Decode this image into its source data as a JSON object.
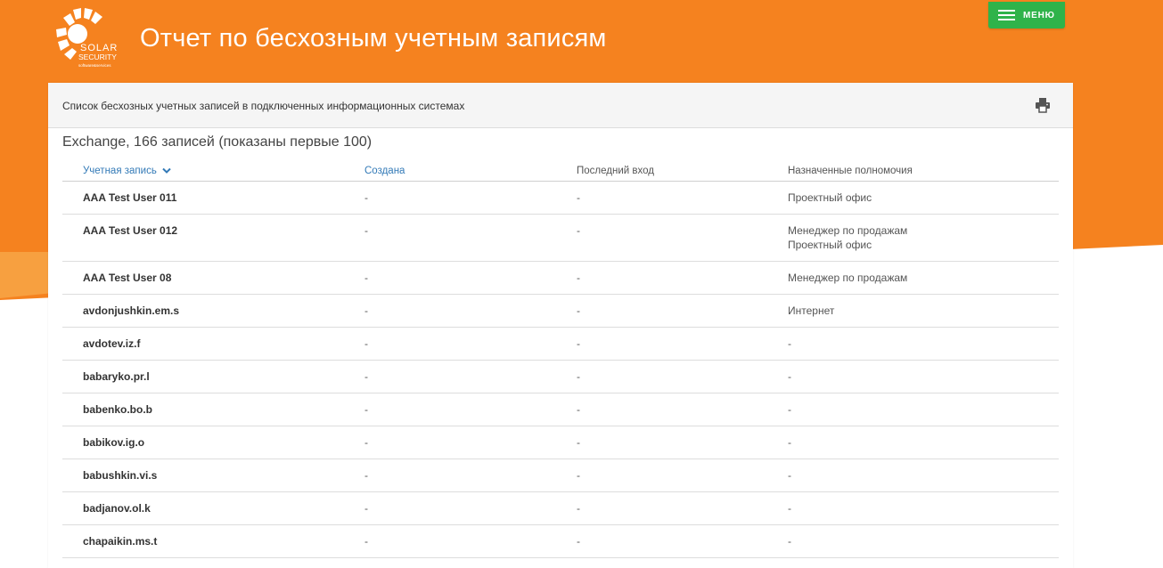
{
  "header": {
    "logo_text_1": "SOLAR",
    "logo_text_2": "SECURITY",
    "logo_text_3": "software&services",
    "title": "Отчет по бесхозным учетным записям",
    "menu_label": "МЕНЮ"
  },
  "panel": {
    "description": "Список бесхозных учетных записей в подключенных информационных системах",
    "print_icon": "printer-icon",
    "section_title": "Exchange, 166 записей (показаны первые 100)"
  },
  "table": {
    "columns": [
      "Учетная запись",
      "Создана",
      "Последний вход",
      "Назначенные полномочия"
    ],
    "sort_icon": "chevron-down-icon",
    "rows": [
      {
        "account": "AAA Test User 011",
        "created": "-",
        "last_login": "-",
        "permissions": [
          "Проектный офис"
        ]
      },
      {
        "account": "AAA Test User 012",
        "created": "-",
        "last_login": "-",
        "permissions": [
          "Менеджер по продажам",
          "Проектный офис"
        ]
      },
      {
        "account": "AAA Test User 08",
        "created": "-",
        "last_login": "-",
        "permissions": [
          "Менеджер по продажам"
        ]
      },
      {
        "account": "avdonjushkin.em.s",
        "created": "-",
        "last_login": "-",
        "permissions": [
          "Интернет"
        ]
      },
      {
        "account": "avdotev.iz.f",
        "created": "-",
        "last_login": "-",
        "permissions": [
          "-"
        ]
      },
      {
        "account": "babaryko.pr.l",
        "created": "-",
        "last_login": "-",
        "permissions": [
          "-"
        ]
      },
      {
        "account": "babenko.bo.b",
        "created": "-",
        "last_login": "-",
        "permissions": [
          "-"
        ]
      },
      {
        "account": "babikov.ig.o",
        "created": "-",
        "last_login": "-",
        "permissions": [
          "-"
        ]
      },
      {
        "account": "babushkin.vi.s",
        "created": "-",
        "last_login": "-",
        "permissions": [
          "-"
        ]
      },
      {
        "account": "badjanov.ol.k",
        "created": "-",
        "last_login": "-",
        "permissions": [
          "-"
        ]
      },
      {
        "account": "chapaikin.ms.t",
        "created": "-",
        "last_login": "-",
        "permissions": [
          "-"
        ]
      }
    ]
  },
  "colors": {
    "brand_orange": "#f5821f",
    "menu_green": "#2fb34a",
    "link_blue": "#337ab7"
  }
}
